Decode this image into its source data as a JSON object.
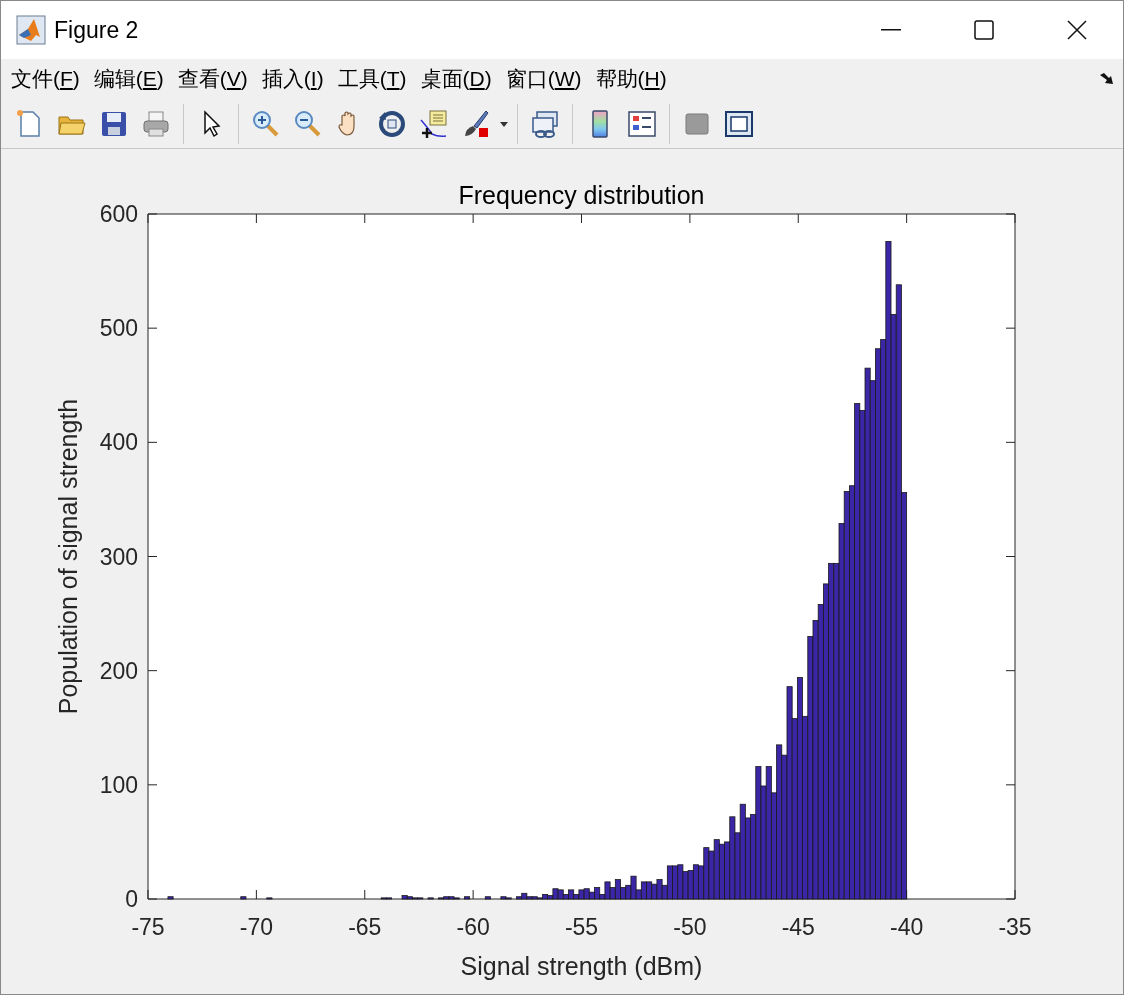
{
  "window": {
    "title": "Figure 2"
  },
  "menu": [
    {
      "label": "文件(F)"
    },
    {
      "label": "编辑(E)"
    },
    {
      "label": "查看(V)"
    },
    {
      "label": "插入(I)"
    },
    {
      "label": "工具(T)"
    },
    {
      "label": "桌面(D)"
    },
    {
      "label": "窗口(W)"
    },
    {
      "label": "帮助(H)"
    }
  ],
  "figure": {
    "chart_data": {
      "type": "bar",
      "title": "Frequency distribution",
      "xlabel": "Signal strength (dBm)",
      "ylabel": "Population of signal strength",
      "xlim": [
        -75,
        -35
      ],
      "ylim": [
        0,
        600
      ],
      "xticks": [
        -75,
        -70,
        -65,
        -60,
        -55,
        -50,
        -45,
        -40,
        -35
      ],
      "yticks": [
        0,
        100,
        200,
        300,
        400,
        500,
        600
      ],
      "x": [
        -73.96,
        -73.72,
        -73.48,
        -73.24,
        -73.0,
        -72.76,
        -72.52,
        -72.28,
        -72.04,
        -71.8,
        -71.56,
        -71.32,
        -71.08,
        -70.84,
        -70.6,
        -70.36,
        -70.12,
        -69.88,
        -69.64,
        -69.4,
        -69.16,
        -68.92,
        -68.68,
        -68.44,
        -68.2,
        -67.96,
        -67.72,
        -67.48,
        -67.24,
        -67.0,
        -66.76,
        -66.52,
        -66.28,
        -66.04,
        -65.8,
        -65.56,
        -65.32,
        -65.08,
        -64.84,
        -64.6,
        -64.36,
        -64.12,
        -63.88,
        -63.64,
        -63.4,
        -63.16,
        -62.92,
        -62.68,
        -62.44,
        -62.2,
        -61.96,
        -61.72,
        -61.48,
        -61.24,
        -61.0,
        -60.76,
        -60.52,
        -60.28,
        -60.04,
        -59.8,
        -59.56,
        -59.32,
        -59.08,
        -58.84,
        -58.6,
        -58.36,
        -58.12,
        -57.88,
        -57.64,
        -57.4,
        -57.16,
        -56.92,
        -56.68,
        -56.44,
        -56.2,
        -55.96,
        -55.72,
        -55.48,
        -55.24,
        -55.0,
        -54.76,
        -54.52,
        -54.28,
        -54.04,
        -53.8,
        -53.56,
        -53.32,
        -53.08,
        -52.84,
        -52.6,
        -52.36,
        -52.12,
        -51.88,
        -51.64,
        -51.4,
        -51.16,
        -50.92,
        -50.68,
        -50.44,
        -50.2,
        -49.96,
        -49.72,
        -49.48,
        -49.24,
        -49.0,
        -48.76,
        -48.52,
        -48.28,
        -48.04,
        -47.8,
        -47.56,
        -47.32,
        -47.08,
        -46.84,
        -46.6,
        -46.36,
        -46.12,
        -45.88,
        -45.64,
        -45.4,
        -45.16,
        -44.92,
        -44.68,
        -44.44,
        -44.2,
        -43.96,
        -43.72,
        -43.48,
        -43.24,
        -43.0,
        -42.76,
        -42.52,
        -42.28,
        -42.04,
        -41.8,
        -41.56,
        -41.32,
        -41.08,
        -40.84,
        -40.6,
        -40.36,
        -40.12
      ],
      "series": [
        {
          "color": "#3a26a6",
          "values": [
            2,
            0,
            0,
            0,
            0,
            0,
            0,
            0,
            0,
            0,
            0,
            0,
            0,
            0,
            2,
            0,
            0,
            0,
            0,
            1,
            0,
            0,
            0,
            0,
            0,
            0,
            0,
            0,
            0,
            0,
            0,
            0,
            0,
            0,
            0,
            0,
            0,
            0,
            0,
            0,
            0,
            1,
            1,
            0,
            0,
            3,
            2,
            1,
            1,
            0,
            1,
            0,
            1,
            2,
            2,
            1,
            0,
            2,
            0,
            0,
            0,
            2,
            0,
            0,
            2,
            1,
            0,
            2,
            5,
            2,
            2,
            1,
            4,
            3,
            9,
            8,
            4,
            8,
            4,
            8,
            9,
            6,
            10,
            4,
            15,
            10,
            17,
            10,
            12,
            20,
            8,
            15,
            15,
            13,
            17,
            12,
            29,
            29,
            30,
            24,
            25,
            30,
            29,
            45,
            42,
            52,
            48,
            50,
            72,
            58,
            83,
            71,
            74,
            116,
            99,
            116,
            93,
            135,
            126,
            186,
            158,
            194,
            160,
            230,
            244,
            258,
            276,
            294,
            294,
            329,
            357,
            362,
            434,
            428,
            465,
            454,
            482,
            490,
            576,
            512,
            538,
            356
          ]
        }
      ]
    }
  }
}
